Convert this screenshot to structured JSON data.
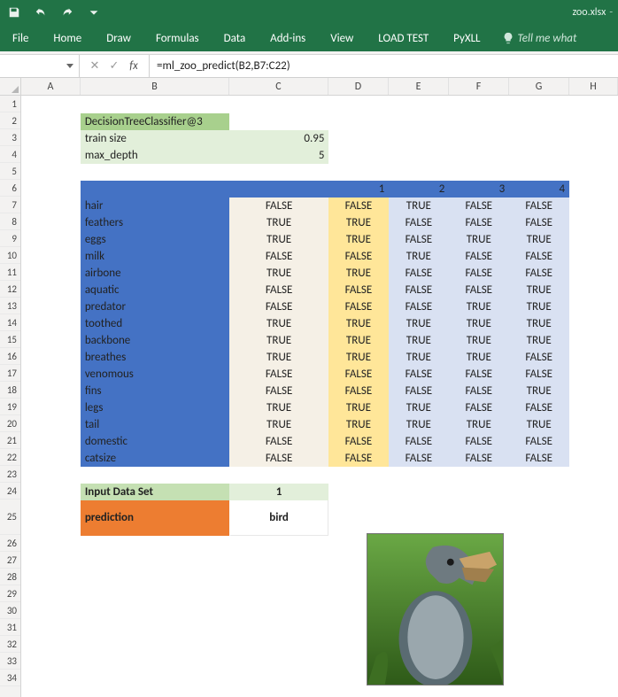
{
  "titlebar": {
    "filename": "zoo.xlsx",
    "dash": "-"
  },
  "qat": {
    "save": "save-icon",
    "undo": "undo-icon",
    "redo": "redo-icon",
    "customize": "customize-qat-icon"
  },
  "ribbon": {
    "tabs": [
      "File",
      "Home",
      "Draw",
      "Formulas",
      "Data",
      "Add-ins",
      "View",
      "LOAD TEST",
      "PyXLL"
    ],
    "tellme": "Tell me what"
  },
  "formulabar": {
    "namebox": "",
    "formula": "=ml_zoo_predict(B2,B7:C22)",
    "fx": "fx"
  },
  "columns": [
    "A",
    "B",
    "C",
    "D",
    "E",
    "F",
    "G",
    "H"
  ],
  "rows": 34,
  "model": {
    "title": "DecisionTreeClassifier@3",
    "params": [
      {
        "label": "train size",
        "value": "0.95"
      },
      {
        "label": "max_depth",
        "value": "5"
      }
    ]
  },
  "grid": {
    "header_nums": [
      "1",
      "2",
      "3",
      "4"
    ],
    "features": [
      {
        "name": "hair",
        "v": [
          "FALSE",
          "FALSE",
          "TRUE",
          "FALSE",
          "FALSE"
        ]
      },
      {
        "name": "feathers",
        "v": [
          "TRUE",
          "TRUE",
          "FALSE",
          "FALSE",
          "FALSE"
        ]
      },
      {
        "name": "eggs",
        "v": [
          "TRUE",
          "TRUE",
          "FALSE",
          "TRUE",
          "TRUE"
        ]
      },
      {
        "name": "milk",
        "v": [
          "FALSE",
          "FALSE",
          "TRUE",
          "FALSE",
          "FALSE"
        ]
      },
      {
        "name": "airbone",
        "v": [
          "TRUE",
          "TRUE",
          "FALSE",
          "FALSE",
          "FALSE"
        ]
      },
      {
        "name": "aquatic",
        "v": [
          "FALSE",
          "FALSE",
          "FALSE",
          "FALSE",
          "TRUE"
        ]
      },
      {
        "name": "predator",
        "v": [
          "FALSE",
          "FALSE",
          "FALSE",
          "TRUE",
          "TRUE"
        ]
      },
      {
        "name": "toothed",
        "v": [
          "TRUE",
          "TRUE",
          "TRUE",
          "TRUE",
          "TRUE"
        ]
      },
      {
        "name": "backbone",
        "v": [
          "TRUE",
          "TRUE",
          "TRUE",
          "TRUE",
          "TRUE"
        ]
      },
      {
        "name": "breathes",
        "v": [
          "TRUE",
          "TRUE",
          "TRUE",
          "TRUE",
          "FALSE"
        ]
      },
      {
        "name": "venomous",
        "v": [
          "FALSE",
          "FALSE",
          "FALSE",
          "FALSE",
          "FALSE"
        ]
      },
      {
        "name": "fins",
        "v": [
          "FALSE",
          "FALSE",
          "FALSE",
          "FALSE",
          "TRUE"
        ]
      },
      {
        "name": "legs",
        "v": [
          "TRUE",
          "TRUE",
          "TRUE",
          "FALSE",
          "FALSE"
        ]
      },
      {
        "name": "tail",
        "v": [
          "TRUE",
          "TRUE",
          "TRUE",
          "TRUE",
          "TRUE"
        ]
      },
      {
        "name": "domestic",
        "v": [
          "FALSE",
          "FALSE",
          "FALSE",
          "FALSE",
          "FALSE"
        ]
      },
      {
        "name": "catsize",
        "v": [
          "FALSE",
          "FALSE",
          "FALSE",
          "FALSE",
          "FALSE"
        ]
      }
    ]
  },
  "inputset": {
    "label": "Input Data Set",
    "value": "1"
  },
  "prediction": {
    "label": "prediction",
    "value": "bird"
  }
}
